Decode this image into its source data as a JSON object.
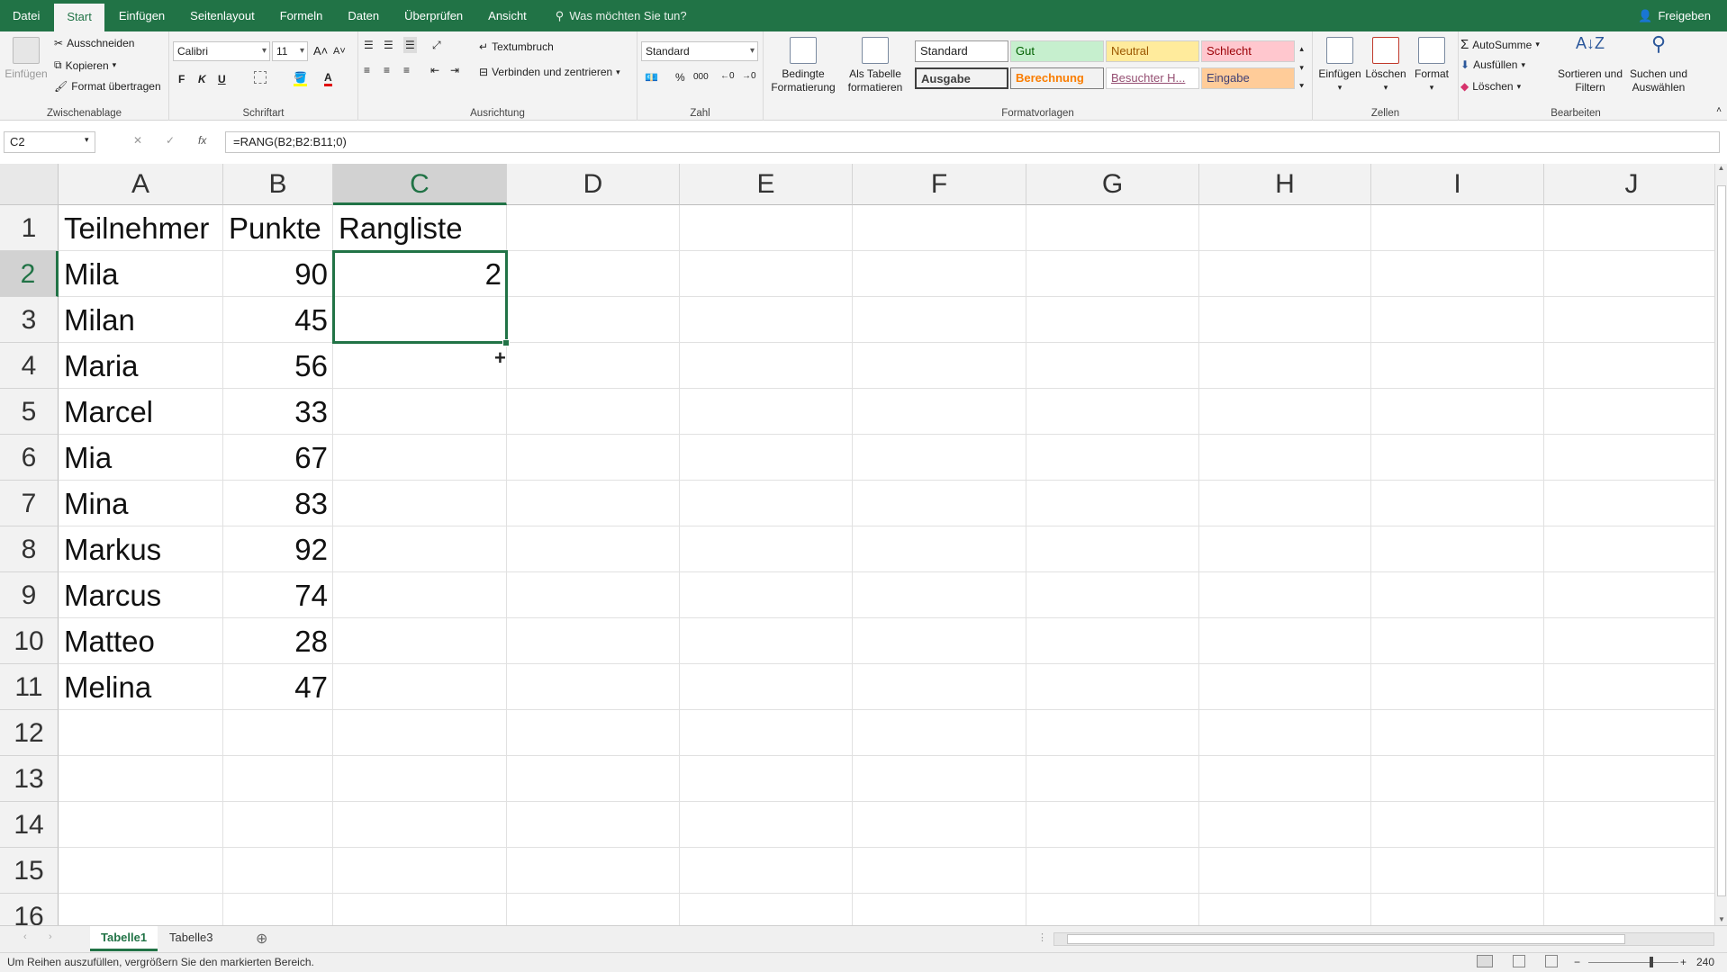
{
  "menu": {
    "tabs": [
      "Datei",
      "Start",
      "Einfügen",
      "Seitenlayout",
      "Formeln",
      "Daten",
      "Überprüfen",
      "Ansicht"
    ],
    "tellme": "Was möchten Sie tun?",
    "share": "Freigeben"
  },
  "ribbon": {
    "clipboard": {
      "paste": "Einfügen",
      "cut": "Ausschneiden",
      "copy": "Kopieren",
      "painter": "Format übertragen",
      "label": "Zwischenablage"
    },
    "font": {
      "name": "Calibri",
      "size": "11",
      "bold": "F",
      "italic": "K",
      "underline": "U",
      "label": "Schriftart"
    },
    "alignment": {
      "wrap": "Textumbruch",
      "merge": "Verbinden und zentrieren",
      "label": "Ausrichtung"
    },
    "number": {
      "format": "Standard",
      "percent": "%",
      "thousands": "000",
      "label": "Zahl"
    },
    "conditional": {
      "line1": "Bedingte",
      "line2": "Formatierung"
    },
    "astable": {
      "line1": "Als Tabelle",
      "line2": "formatieren"
    },
    "styles": {
      "label": "Formatvorlagen",
      "items": [
        "Standard",
        "Gut",
        "Neutral",
        "Schlecht",
        "Ausgabe",
        "Berechnung",
        "Besuchter H...",
        "Eingabe"
      ]
    },
    "cells": {
      "insert": "Einfügen",
      "delete": "Löschen",
      "format": "Format",
      "label": "Zellen"
    },
    "editing": {
      "autosum": "AutoSumme",
      "fill": "Ausfüllen",
      "clear": "Löschen",
      "sort_l1": "Sortieren und",
      "sort_l2": "Filtern",
      "find_l1": "Suchen und",
      "find_l2": "Auswählen",
      "label": "Bearbeiten"
    }
  },
  "formula_bar": {
    "name_box": "C2",
    "formula": "=RANG(B2;B2:B11;0)",
    "fx": "fx"
  },
  "sheet": {
    "columns": [
      "A",
      "B",
      "C",
      "D",
      "E",
      "F",
      "G",
      "H",
      "I",
      "J"
    ],
    "rows": [
      "1",
      "2",
      "3",
      "4",
      "5",
      "6",
      "7",
      "8",
      "9",
      "10",
      "11",
      "12",
      "13",
      "14",
      "15",
      "16"
    ],
    "header": {
      "a": "Teilnehmer",
      "b": "Punkte",
      "c": "Rangliste"
    },
    "data": [
      {
        "name": "Mila",
        "points": "90",
        "rank": "2"
      },
      {
        "name": "Milan",
        "points": "45",
        "rank": ""
      },
      {
        "name": "Maria",
        "points": "56",
        "rank": ""
      },
      {
        "name": "Marcel",
        "points": "33",
        "rank": ""
      },
      {
        "name": "Mia",
        "points": "67",
        "rank": ""
      },
      {
        "name": "Mina",
        "points": "83",
        "rank": ""
      },
      {
        "name": "Markus",
        "points": "92",
        "rank": ""
      },
      {
        "name": "Marcus",
        "points": "74",
        "rank": ""
      },
      {
        "name": "Matteo",
        "points": "28",
        "rank": ""
      },
      {
        "name": "Melina",
        "points": "47",
        "rank": ""
      }
    ],
    "fill_cursor": "+"
  },
  "sheet_tabs": {
    "tabs": [
      "Tabelle1",
      "Tabelle3"
    ],
    "add": "⊕"
  },
  "status": {
    "message": "Um Reihen auszufüllen, vergrößern Sie den markierten Bereich.",
    "zoom": "240 %"
  },
  "colors": {
    "accent": "#217346",
    "good_bg": "#c6efce",
    "good_fg": "#006100",
    "neutral_bg": "#ffeb9c",
    "neutral_fg": "#9c5700",
    "bad_bg": "#ffc7ce",
    "bad_fg": "#9c0006",
    "input_bg": "#ffcc99",
    "input_fg": "#3f3f76",
    "calc_fg": "#fa7d00",
    "visited_fg": "#954f72"
  }
}
